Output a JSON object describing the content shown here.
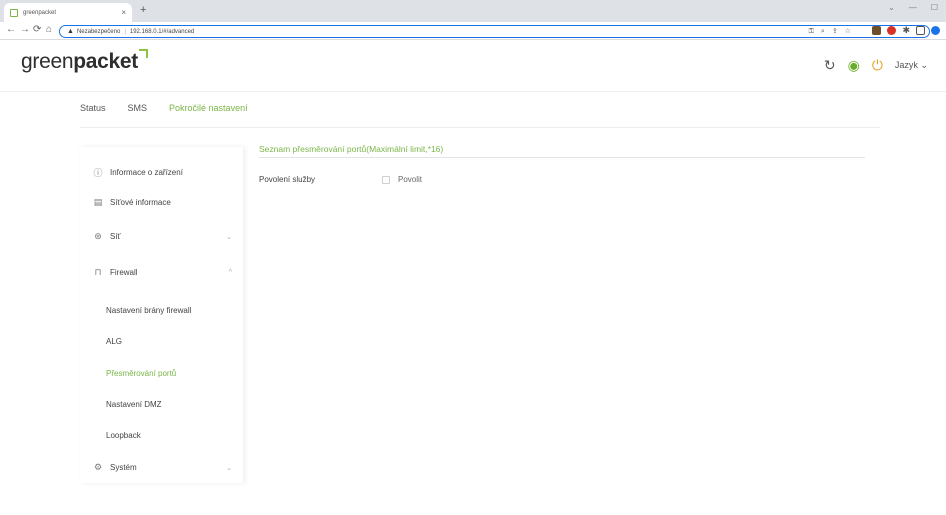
{
  "browser": {
    "tab_title": "greenpacket",
    "tab_close": "×",
    "new_tab": "+",
    "security_label": "Nezabezpečeno",
    "url": "192.168.0.1/#/advanced"
  },
  "header": {
    "logo_light": "green",
    "logo_bold": "packet",
    "language_label": "Jazyk"
  },
  "nav": {
    "tabs": [
      {
        "label": "Status"
      },
      {
        "label": "SMS"
      },
      {
        "label": "Pokročilé nastavení"
      }
    ]
  },
  "sidebar": {
    "items": [
      {
        "label": "Informace o zařízení",
        "icon": "info-icon"
      },
      {
        "label": "Síťové informace",
        "icon": "document-icon"
      },
      {
        "label": "Síť",
        "icon": "network-icon"
      },
      {
        "label": "Firewall",
        "icon": "lock-icon"
      },
      {
        "label": "Systém",
        "icon": "settings-icon"
      }
    ],
    "firewall_sub": [
      {
        "label": "Nastavení brány firewall"
      },
      {
        "label": "ALG"
      },
      {
        "label": "Přesměrování portů"
      },
      {
        "label": "Nastavení DMZ"
      },
      {
        "label": "Loopback"
      }
    ]
  },
  "content": {
    "section_title": "Seznam přesměrování portů(Maximální limit,*16)",
    "service_label": "Povolení služby",
    "enable_label": "Povolit",
    "enable_checked": false
  },
  "colors": {
    "accent": "#7ab648",
    "text": "#444444"
  }
}
